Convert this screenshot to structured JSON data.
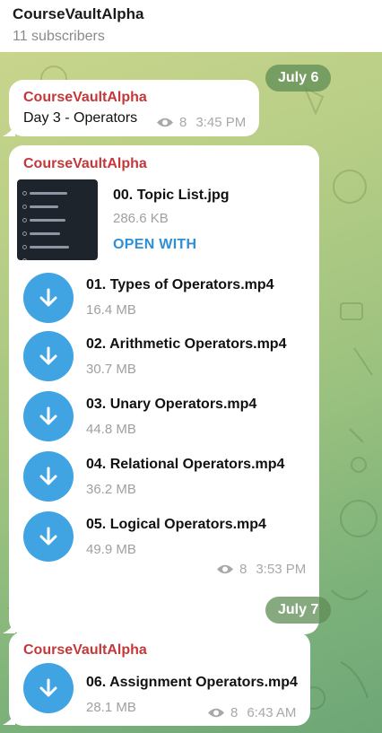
{
  "header": {
    "title": "CourseVaultAlpha",
    "subtitle": "11 subscribers"
  },
  "dates": [
    "July 6",
    "July 7"
  ],
  "posts": [
    {
      "sender": "CourseVaultAlpha",
      "text": "Day 3 - Operators",
      "views": "8",
      "time": "3:45 PM"
    },
    {
      "sender": "CourseVaultAlpha",
      "image_file": {
        "name": "00. Topic List.jpg",
        "size": "286.6 KB",
        "action": "OPEN WITH"
      },
      "files": [
        {
          "name": "01. Types of Operators.mp4",
          "size": "16.4 MB"
        },
        {
          "name": "02. Arithmetic Operators.mp4",
          "size": "30.7 MB"
        },
        {
          "name": "03. Unary Operators.mp4",
          "size": "44.8 MB"
        },
        {
          "name": "04. Relational Operators.mp4",
          "size": "36.2 MB"
        },
        {
          "name": "05. Logical Operators.mp4",
          "size": "49.9 MB"
        }
      ],
      "views": "8",
      "time": "3:53 PM"
    },
    {
      "sender": "CourseVaultAlpha",
      "files": [
        {
          "name": "06. Assignment Operators.mp4",
          "size": "28.1 MB"
        }
      ],
      "views": "8",
      "time": "6:43 AM"
    }
  ],
  "thumbnail": {
    "items": [
      "Arithmetic Operators",
      "Unary Operators",
      "Relational Operators",
      "Logical Operators",
      "Assignment Operators",
      "Reading Material - Operator Precedence"
    ]
  },
  "colors": {
    "sender": "#c5383a",
    "download_button": "#40a4e3",
    "link": "#2e8fd6",
    "date_pill": "#5f8c55"
  },
  "icons": {
    "download": "download-arrow-icon",
    "views": "eye-icon"
  }
}
